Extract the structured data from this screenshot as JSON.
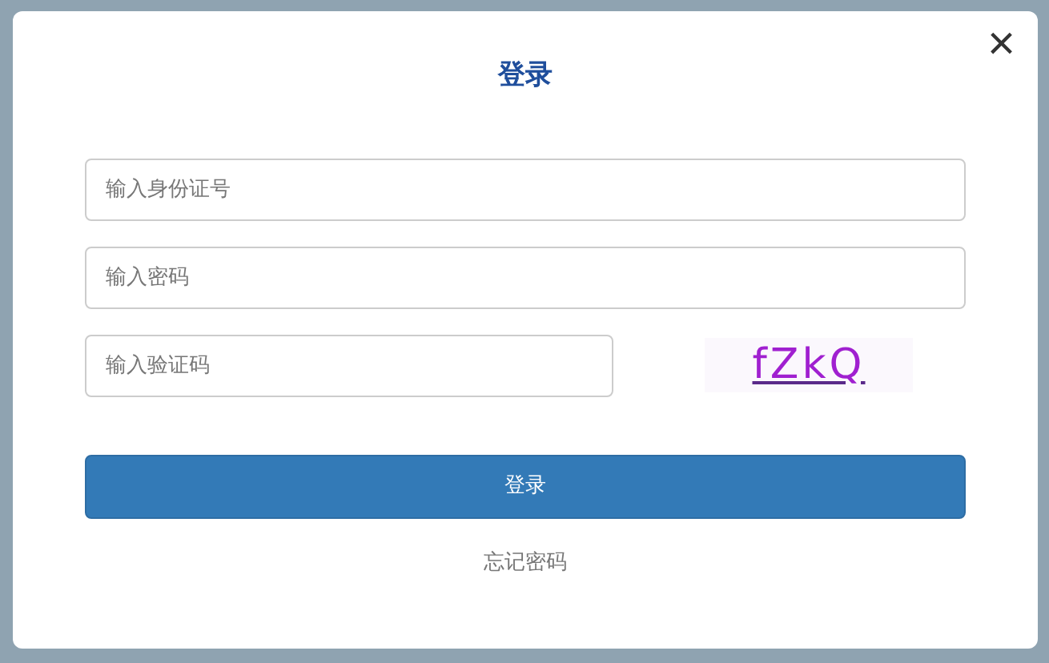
{
  "dialog": {
    "title": "登录",
    "close": "×"
  },
  "fields": [
    {
      "placeholder": "输入身份证号"
    },
    {
      "placeholder": "输入密码"
    }
  ],
  "captcha": {
    "placeholder": "输入验证码",
    "code": "fZkQ"
  },
  "submit": "登录",
  "forgot_link": "忘记密码"
}
